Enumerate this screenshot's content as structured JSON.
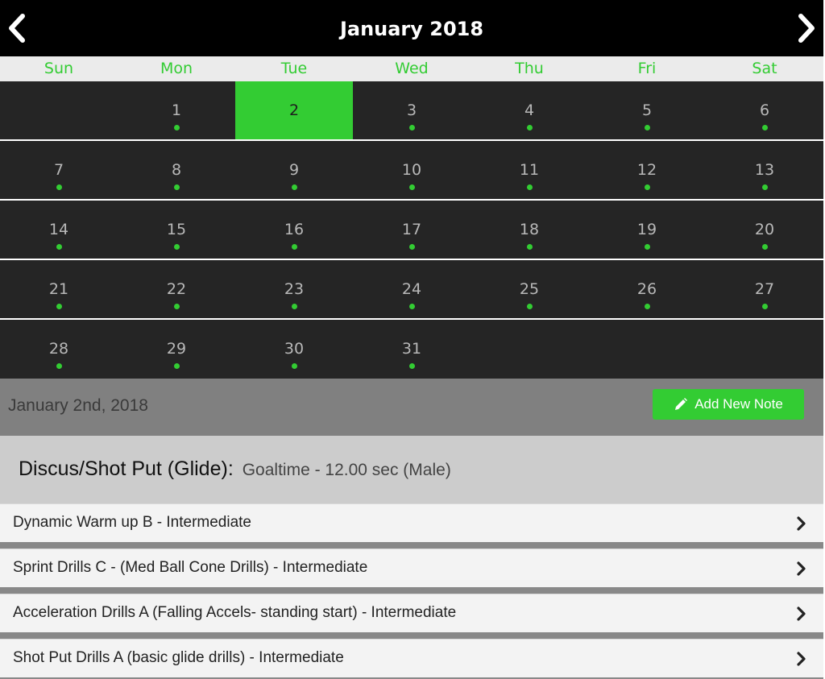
{
  "calendar": {
    "month_title": "January 2018",
    "weekdays": [
      "Sun",
      "Mon",
      "Tue",
      "Wed",
      "Thu",
      "Fri",
      "Sat"
    ],
    "weeks": [
      [
        "",
        "1",
        "2",
        "3",
        "4",
        "5",
        "6"
      ],
      [
        "7",
        "8",
        "9",
        "10",
        "11",
        "12",
        "13"
      ],
      [
        "14",
        "15",
        "16",
        "17",
        "18",
        "19",
        "20"
      ],
      [
        "21",
        "22",
        "23",
        "24",
        "25",
        "26",
        "27"
      ],
      [
        "28",
        "29",
        "30",
        "31",
        "",
        "",
        ""
      ]
    ],
    "selected_day": "2"
  },
  "day_panel": {
    "date_label": "January 2nd, 2018",
    "add_note_label": "Add New Note"
  },
  "workout": {
    "title": "Discus/Shot Put (Glide):",
    "subtitle": "Goaltime - 12.00 sec (Male)",
    "items": [
      "Dynamic Warm up B - Intermediate",
      "Sprint Drills C - (Med Ball Cone Drills) - Intermediate",
      "Acceleration Drills A (Falling Accels- standing start) - Intermediate",
      "Shot Put Drills A (basic glide drills) - Intermediate"
    ]
  },
  "icons": {
    "prev": "chevron-left-icon",
    "next": "chevron-right-icon",
    "note": "pencil-icon",
    "item": "chevron-right-icon"
  },
  "colors": {
    "accent": "#33cc33",
    "header_bg": "#000000",
    "calendar_bg": "#252525"
  }
}
